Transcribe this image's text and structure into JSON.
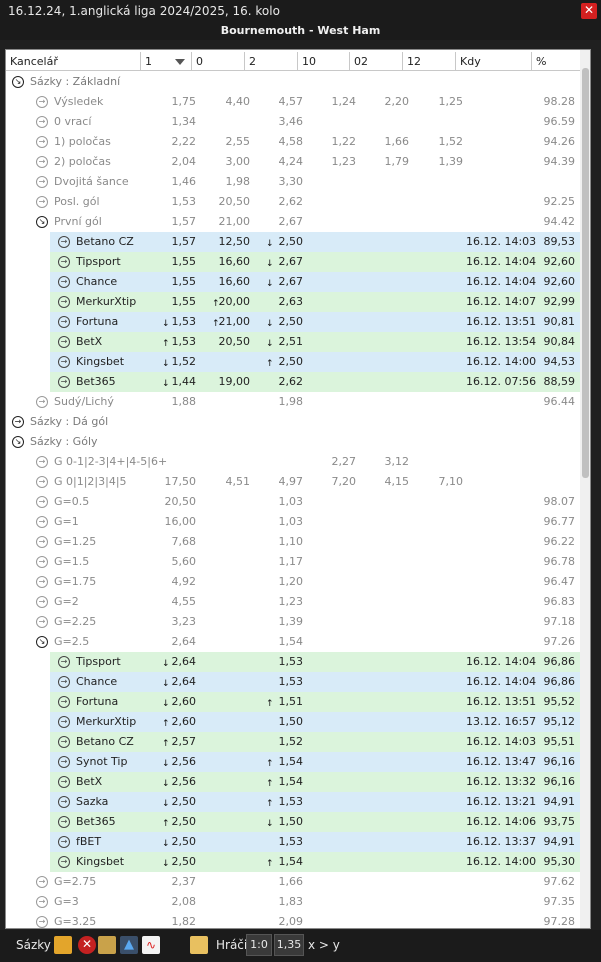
{
  "window": {
    "title": "16.12.24, 1.anglická liga 2024/2025, 16. kolo",
    "close_label": "✕"
  },
  "match": {
    "title": "Bournemouth - West Ham"
  },
  "columns": {
    "bookmaker": "Kancelář",
    "c1": "1",
    "c0": "0",
    "c2": "2",
    "c10": "10",
    "c02": "02",
    "c12": "12",
    "when": "Kdy",
    "pct": "%"
  },
  "rows": [
    {
      "kind": "group",
      "name": "Sázky : Základní",
      "icon": "collapse-icon",
      "o1": "",
      "o0": "",
      "o2": "",
      "o10": "",
      "o02": "",
      "o12": "",
      "when": "",
      "pct": ""
    },
    {
      "kind": "market",
      "name": "Výsledek",
      "icon": "expand-icon",
      "o1": "1,75",
      "o0": "4,40",
      "o2": "4,57",
      "o10": "1,24",
      "o02": "2,20",
      "o12": "1,25",
      "when": "",
      "pct": "98.28"
    },
    {
      "kind": "market",
      "name": "0 vrací",
      "icon": "expand-icon",
      "o1": "1,34",
      "o0": "",
      "o2": "3,46",
      "o10": "",
      "o02": "",
      "o12": "",
      "when": "",
      "pct": "96.59"
    },
    {
      "kind": "market",
      "name": "1) poločas",
      "icon": "expand-icon",
      "o1": "2,22",
      "o0": "2,55",
      "o2": "4,58",
      "o10": "1,22",
      "o02": "1,66",
      "o12": "1,52",
      "when": "",
      "pct": "94.26"
    },
    {
      "kind": "market",
      "name": "2) poločas",
      "icon": "expand-icon",
      "o1": "2,04",
      "o0": "3,00",
      "o2": "4,24",
      "o10": "1,23",
      "o02": "1,79",
      "o12": "1,39",
      "when": "",
      "pct": "94.39"
    },
    {
      "kind": "market",
      "name": "Dvojitá šance",
      "icon": "expand-icon",
      "o1": "1,46",
      "o0": "1,98",
      "o2": "3,30",
      "o10": "",
      "o02": "",
      "o12": "",
      "when": "",
      "pct": ""
    },
    {
      "kind": "selected",
      "name": "Posl. gól",
      "icon": "expand-icon",
      "o1": "1,53",
      "o0": "20,50",
      "o2": "2,62",
      "o10": "",
      "o02": "",
      "o12": "",
      "when": "",
      "pct": "92.25"
    },
    {
      "kind": "open",
      "name": "První gól",
      "icon": "collapse-icon",
      "o1": "1,57",
      "o0": "21,00",
      "o2": "2,67",
      "o10": "",
      "o02": "",
      "o12": "",
      "when": "",
      "pct": "94.42"
    },
    {
      "kind": "odd",
      "name": "Betano CZ",
      "icon": "expand-icon",
      "o1": "1,57",
      "o0": "12,50",
      "a2": "↓",
      "o2": "2,50",
      "o10": "",
      "o02": "",
      "o12": "",
      "when": "16.12. 14:03",
      "pct": "89,53"
    },
    {
      "kind": "even",
      "name": "Tipsport",
      "icon": "expand-icon",
      "o1": "1,55",
      "o0": "16,60",
      "a2": "↓",
      "o2": "2,67",
      "o10": "",
      "o02": "",
      "o12": "",
      "when": "16.12. 14:04",
      "pct": "92,60"
    },
    {
      "kind": "odd",
      "name": "Chance",
      "icon": "expand-icon",
      "o1": "1,55",
      "o0": "16,60",
      "a2": "↓",
      "o2": "2,67",
      "o10": "",
      "o02": "",
      "o12": "",
      "when": "16.12. 14:04",
      "pct": "92,60"
    },
    {
      "kind": "even",
      "name": "MerkurXtip",
      "icon": "expand-icon",
      "o1": "1,55",
      "a0": "↑",
      "o0": "20,00",
      "o2": "2,63",
      "o10": "",
      "o02": "",
      "o12": "",
      "when": "16.12. 14:07",
      "pct": "92,99"
    },
    {
      "kind": "odd",
      "name": "Fortuna",
      "icon": "expand-icon",
      "a1": "↓",
      "o1": "1,53",
      "a0": "↑",
      "o0": "21,00",
      "a2": "↓",
      "o2": "2,50",
      "o10": "",
      "o02": "",
      "o12": "",
      "when": "16.12. 13:51",
      "pct": "90,81"
    },
    {
      "kind": "even",
      "name": "BetX",
      "icon": "expand-icon",
      "a1": "↑",
      "o1": "1,53",
      "o0": "20,50",
      "a2": "↓",
      "o2": "2,51",
      "o10": "",
      "o02": "",
      "o12": "",
      "when": "16.12. 13:54",
      "pct": "90,84"
    },
    {
      "kind": "odd",
      "name": "Kingsbet",
      "icon": "expand-icon",
      "a1": "↓",
      "o1": "1,52",
      "o0": "",
      "a2": "↑",
      "o2": "2,50",
      "o10": "",
      "o02": "",
      "o12": "",
      "when": "16.12. 14:00",
      "pct": "94,53"
    },
    {
      "kind": "even",
      "name": "Bet365",
      "icon": "expand-icon",
      "a1": "↓",
      "o1": "1,44",
      "o0": "19,00",
      "o2": "2,62",
      "o10": "",
      "o02": "",
      "o12": "",
      "when": "16.12. 07:56",
      "pct": "88,59"
    },
    {
      "kind": "market",
      "name": "Sudý/Lichý",
      "icon": "expand-icon",
      "o1": "1,88",
      "o0": "",
      "o2": "1,98",
      "o10": "",
      "o02": "",
      "o12": "",
      "when": "",
      "pct": "96.44"
    },
    {
      "kind": "group",
      "name": "Sázky : Dá gól",
      "icon": "expand-icon",
      "o1": "",
      "o0": "",
      "o2": "",
      "o10": "",
      "o02": "",
      "o12": "",
      "when": "",
      "pct": ""
    },
    {
      "kind": "group",
      "name": "Sázky : Góly",
      "icon": "collapse-icon",
      "o1": "",
      "o0": "",
      "o2": "",
      "o10": "",
      "o02": "",
      "o12": "",
      "when": "",
      "pct": ""
    },
    {
      "kind": "market",
      "name": "G 0-1|2-3|4+|4-5|6+",
      "icon": "expand-icon",
      "o1": "",
      "o0": "",
      "o2": "",
      "o10": "2,27",
      "o02": "3,12",
      "o12": "",
      "when": "",
      "pct": ""
    },
    {
      "kind": "market",
      "name": "G 0|1|2|3|4|5",
      "icon": "expand-icon",
      "o1": "17,50",
      "o0": "4,51",
      "o2": "4,97",
      "o10": "7,20",
      "o02": "4,15",
      "o12": "7,10",
      "when": "",
      "pct": ""
    },
    {
      "kind": "market",
      "name": "G=0.5",
      "icon": "expand-icon",
      "o1": "20,50",
      "o0": "",
      "o2": "1,03",
      "o10": "",
      "o02": "",
      "o12": "",
      "when": "",
      "pct": "98.07"
    },
    {
      "kind": "market",
      "name": "G=1",
      "icon": "expand-icon",
      "o1": "16,00",
      "o0": "",
      "o2": "1,03",
      "o10": "",
      "o02": "",
      "o12": "",
      "when": "",
      "pct": "96.77"
    },
    {
      "kind": "market",
      "name": "G=1.25",
      "icon": "expand-icon",
      "o1": "7,68",
      "o0": "",
      "o2": "1,10",
      "o10": "",
      "o02": "",
      "o12": "",
      "when": "",
      "pct": "96.22"
    },
    {
      "kind": "market",
      "name": "G=1.5",
      "icon": "expand-icon",
      "o1": "5,60",
      "o0": "",
      "o2": "1,17",
      "o10": "",
      "o02": "",
      "o12": "",
      "when": "",
      "pct": "96.78"
    },
    {
      "kind": "market",
      "name": "G=1.75",
      "icon": "expand-icon",
      "o1": "4,92",
      "o0": "",
      "o2": "1,20",
      "o10": "",
      "o02": "",
      "o12": "",
      "when": "",
      "pct": "96.47"
    },
    {
      "kind": "market",
      "name": "G=2",
      "icon": "expand-icon",
      "o1": "4,55",
      "o0": "",
      "o2": "1,23",
      "o10": "",
      "o02": "",
      "o12": "",
      "when": "",
      "pct": "96.83"
    },
    {
      "kind": "market",
      "name": "G=2.25",
      "icon": "expand-icon",
      "o1": "3,23",
      "o0": "",
      "o2": "1,39",
      "o10": "",
      "o02": "",
      "o12": "",
      "when": "",
      "pct": "97.18"
    },
    {
      "kind": "open",
      "name": "G=2.5",
      "icon": "collapse-icon",
      "o1": "2,64",
      "o0": "",
      "o2": "1,54",
      "o10": "",
      "o02": "",
      "o12": "",
      "when": "",
      "pct": "97.26"
    },
    {
      "kind": "even",
      "name": "Tipsport",
      "icon": "expand-icon",
      "a1": "↓",
      "o1": "2,64",
      "o0": "",
      "o2": "1,53",
      "o10": "",
      "o02": "",
      "o12": "",
      "when": "16.12. 14:04",
      "pct": "96,86"
    },
    {
      "kind": "odd",
      "name": "Chance",
      "icon": "expand-icon",
      "a1": "↓",
      "o1": "2,64",
      "o0": "",
      "o2": "1,53",
      "o10": "",
      "o02": "",
      "o12": "",
      "when": "16.12. 14:04",
      "pct": "96,86"
    },
    {
      "kind": "even",
      "name": "Fortuna",
      "icon": "expand-icon",
      "a1": "↓",
      "o1": "2,60",
      "o0": "",
      "a2": "↑",
      "o2": "1,51",
      "o10": "",
      "o02": "",
      "o12": "",
      "when": "16.12. 13:51",
      "pct": "95,52"
    },
    {
      "kind": "odd",
      "name": "MerkurXtip",
      "icon": "expand-icon",
      "a1": "↑",
      "o1": "2,60",
      "o0": "",
      "o2": "1,50",
      "o10": "",
      "o02": "",
      "o12": "",
      "when": "13.12. 16:57",
      "pct": "95,12"
    },
    {
      "kind": "even",
      "name": "Betano CZ",
      "icon": "expand-icon",
      "a1": "↑",
      "o1": "2,57",
      "o0": "",
      "o2": "1,52",
      "o10": "",
      "o02": "",
      "o12": "",
      "when": "16.12. 14:03",
      "pct": "95,51"
    },
    {
      "kind": "odd",
      "name": "Synot Tip",
      "icon": "expand-icon",
      "a1": "↓",
      "o1": "2,56",
      "o0": "",
      "a2": "↑",
      "o2": "1,54",
      "o10": "",
      "o02": "",
      "o12": "",
      "when": "16.12. 13:47",
      "pct": "96,16"
    },
    {
      "kind": "even",
      "name": "BetX",
      "icon": "expand-icon",
      "a1": "↓",
      "o1": "2,56",
      "o0": "",
      "a2": "↑",
      "o2": "1,54",
      "o10": "",
      "o02": "",
      "o12": "",
      "when": "16.12. 13:32",
      "pct": "96,16"
    },
    {
      "kind": "odd",
      "name": "Sazka",
      "icon": "expand-icon",
      "a1": "↓",
      "o1": "2,50",
      "o0": "",
      "a2": "↑",
      "o2": "1,53",
      "o10": "",
      "o02": "",
      "o12": "",
      "when": "16.12. 13:21",
      "pct": "94,91"
    },
    {
      "kind": "even",
      "name": "Bet365",
      "icon": "expand-icon",
      "a1": "↑",
      "o1": "2,50",
      "o0": "",
      "a2": "↓",
      "o2": "1,50",
      "o10": "",
      "o02": "",
      "o12": "",
      "when": "16.12. 14:06",
      "pct": "93,75"
    },
    {
      "kind": "odd",
      "name": "fBET",
      "icon": "expand-icon",
      "a1": "↓",
      "o1": "2,50",
      "o0": "",
      "o2": "1,53",
      "o10": "",
      "o02": "",
      "o12": "",
      "when": "16.12. 13:37",
      "pct": "94,91"
    },
    {
      "kind": "even",
      "name": "Kingsbet",
      "icon": "expand-icon",
      "a1": "↓",
      "o1": "2,50",
      "o0": "",
      "a2": "↑",
      "o2": "1,54",
      "o10": "",
      "o02": "",
      "o12": "",
      "when": "16.12. 14:00",
      "pct": "95,30"
    },
    {
      "kind": "market",
      "name": "G=2.75",
      "icon": "expand-icon",
      "o1": "2,37",
      "o0": "",
      "o2": "1,66",
      "o10": "",
      "o02": "",
      "o12": "",
      "when": "",
      "pct": "97.62"
    },
    {
      "kind": "market",
      "name": "G=3",
      "icon": "expand-icon",
      "o1": "2,08",
      "o0": "",
      "o2": "1,83",
      "o10": "",
      "o02": "",
      "o12": "",
      "when": "",
      "pct": "97.35"
    },
    {
      "kind": "market",
      "name": "G=3.25",
      "icon": "expand-icon",
      "o1": "1,82",
      "o0": "",
      "o2": "2,09",
      "o10": "",
      "o02": "",
      "o12": "",
      "when": "",
      "pct": "97.28"
    }
  ],
  "bottom": {
    "bets_label": "Sázky",
    "players_label": "Hráči",
    "score": "1:0",
    "odds": "1,35",
    "condition": "x > y"
  },
  "colors": {
    "selected": "#07a1ef",
    "row_blue": "#d8ebf8",
    "row_green": "#dbf4dc",
    "close": "#d42020"
  }
}
